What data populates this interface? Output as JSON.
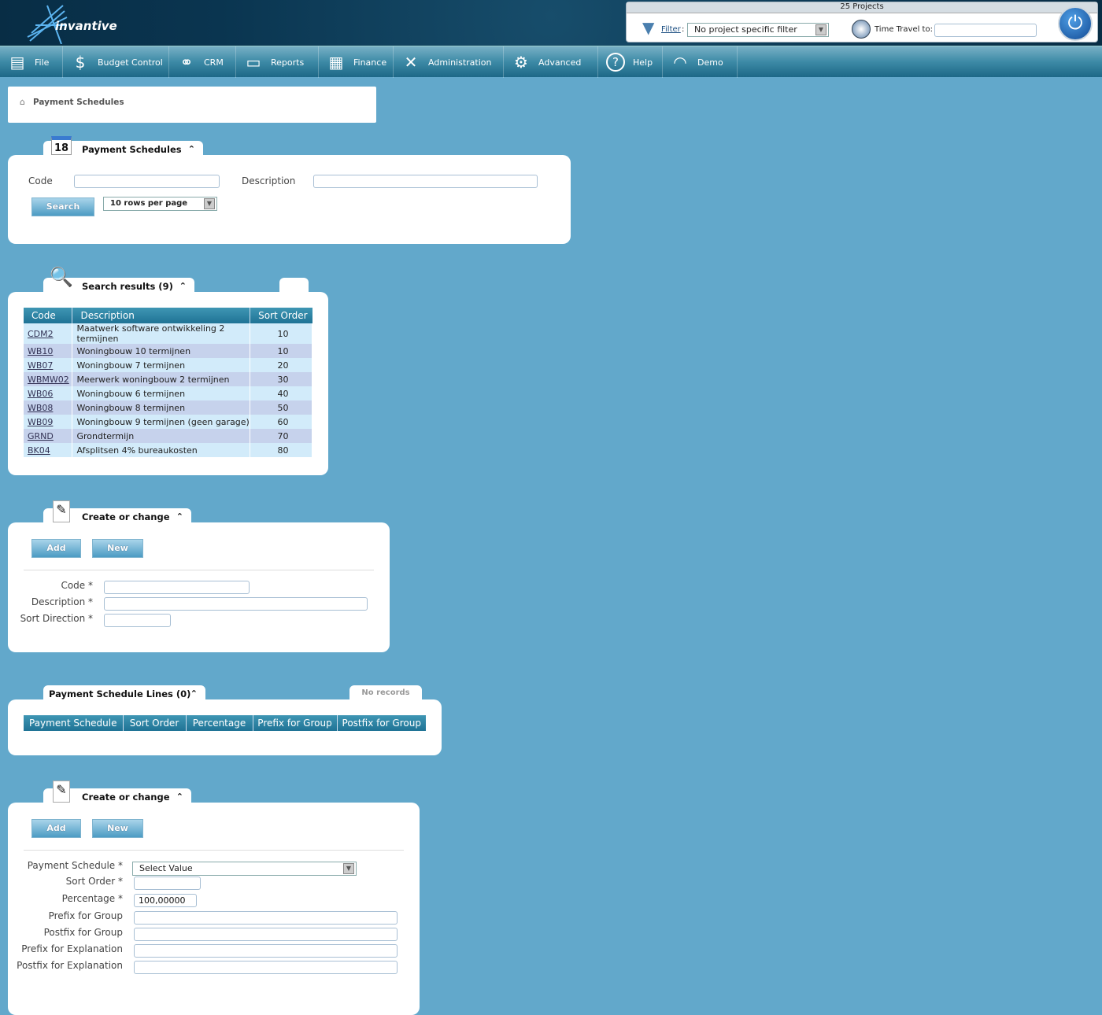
{
  "header": {
    "logo": "invantive",
    "projects": "25 Projects",
    "filter_label": "Filter",
    "filter_value": "No project specific filter",
    "time_travel_label": "Time Travel to:",
    "time_travel_value": ""
  },
  "nav": [
    {
      "label": "File",
      "icon": "cabinet-icon"
    },
    {
      "label": "Budget Control",
      "icon": "money-icon"
    },
    {
      "label": "CRM",
      "icon": "handshake-icon"
    },
    {
      "label": "Reports",
      "icon": "presentation-icon"
    },
    {
      "label": "Finance",
      "icon": "calculator-icon"
    },
    {
      "label": "Administration",
      "icon": "tools-icon"
    },
    {
      "label": "Advanced",
      "icon": "gears-icon"
    },
    {
      "label": "Help",
      "icon": "help-icon"
    },
    {
      "label": "Demo",
      "icon": "demo-icon"
    }
  ],
  "breadcrumb": "Payment Schedules",
  "search_panel": {
    "title": "Payment Schedules",
    "code_label": "Code",
    "code_value": "",
    "description_label": "Description",
    "description_value": "",
    "search_button": "Search",
    "rows_per_page": "10 rows per page"
  },
  "results": {
    "title": "Search results (9)",
    "columns": [
      "Code",
      "Description",
      "Sort Order"
    ],
    "rows": [
      [
        "CDM2",
        "Maatwerk software ontwikkeling 2 termijnen",
        "10"
      ],
      [
        "WB10",
        "Woningbouw 10 termijnen",
        "10"
      ],
      [
        "WB07",
        "Woningbouw 7 termijnen",
        "20"
      ],
      [
        "WBMW02",
        "Meerwerk woningbouw 2 termijnen",
        "30"
      ],
      [
        "WB06",
        "Woningbouw 6 termijnen",
        "40"
      ],
      [
        "WB08",
        "Woningbouw 8 termijnen",
        "50"
      ],
      [
        "WB09",
        "Woningbouw 9 termijnen (geen garage)",
        "60"
      ],
      [
        "GRND",
        "Grondtermijn",
        "70"
      ],
      [
        "BK04",
        "Afsplitsen 4% bureaukosten",
        "80"
      ]
    ]
  },
  "create1": {
    "title": "Create or change",
    "add": "Add",
    "new": "New",
    "fields": [
      {
        "label": "Code *",
        "value": ""
      },
      {
        "label": "Description *",
        "value": ""
      },
      {
        "label": "Sort Direction *",
        "value": ""
      }
    ]
  },
  "lines": {
    "title": "Payment Schedule Lines (0)",
    "status": "No records",
    "columns": [
      "Payment Schedule",
      "Sort Order",
      "Percentage",
      "Prefix for Group",
      "Postfix for Group"
    ]
  },
  "create2": {
    "title": "Create or change",
    "add": "Add",
    "new": "New",
    "payment_schedule_label": "Payment Schedule *",
    "payment_schedule_value": "Select Value",
    "fields": [
      {
        "label": "Sort Order *",
        "value": ""
      },
      {
        "label": "Percentage *",
        "value": "100,00000"
      },
      {
        "label": "Prefix for Group",
        "value": ""
      },
      {
        "label": "Postfix for Group",
        "value": ""
      },
      {
        "label": "Prefix for Explanation",
        "value": ""
      },
      {
        "label": "Postfix for Explanation",
        "value": ""
      }
    ]
  }
}
